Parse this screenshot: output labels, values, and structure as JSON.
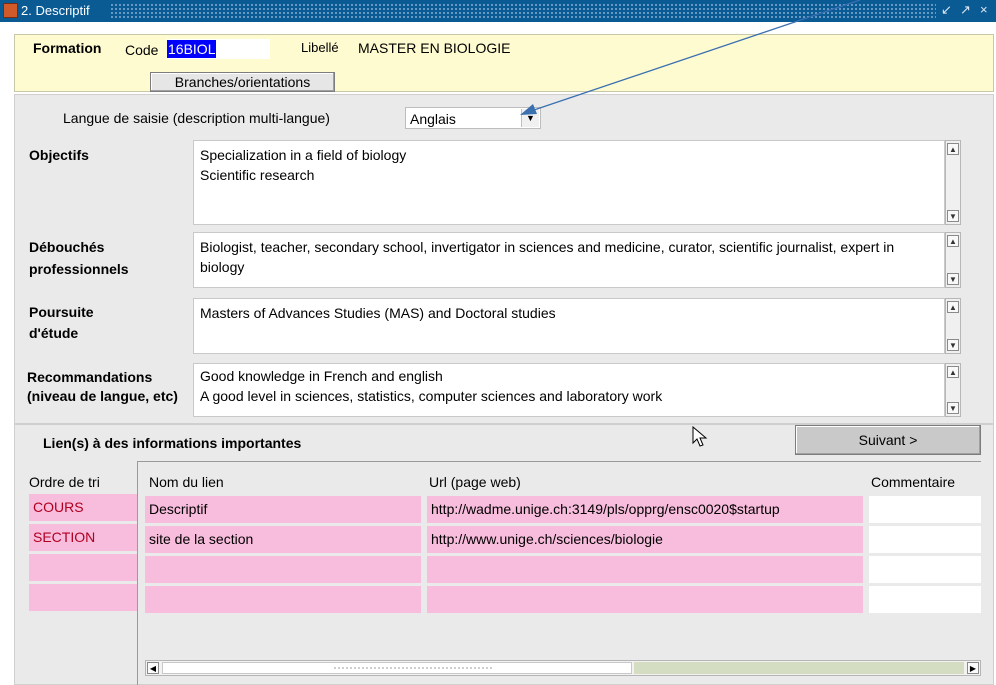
{
  "window": {
    "title": "2. Descriptif",
    "controls": [
      "↙",
      "↗",
      "×"
    ]
  },
  "formation": {
    "section_label": "Formation",
    "code_label": "Code",
    "code_value": "16BIOL",
    "libelle_label": "Libellé",
    "libelle_value": "MASTER EN BIOLOGIE",
    "branches_button": "Branches/orientations"
  },
  "langue": {
    "label": "Langue de saisie (description multi-langue)",
    "selected": "Anglais"
  },
  "objectifs": {
    "label": "Objectifs",
    "text": "Specialization in a field of biology\nScientific research"
  },
  "debouches": {
    "label": "Débouchés professionnels",
    "text": "Biologist, teacher, secondary school, invertigator in sciences and medicine, curator, scientific journalist, expert in biology"
  },
  "poursuite": {
    "label": "Poursuite d'étude",
    "text": "Masters of Advances Studies (MAS) and Doctoral studies"
  },
  "recommandations": {
    "label": "Recommandations (niveau de langue, etc)",
    "text": "Good knowledge in French and english\nA good level in sciences, statistics, computer sciences and laboratory work"
  },
  "liens": {
    "title": "Lien(s) à des informations importantes",
    "next_button": "Suivant >",
    "columns": {
      "ordre": "Ordre de tri",
      "nom": "Nom du lien",
      "url": "Url (page web)",
      "commentaire": "Commentaire"
    },
    "rows": [
      {
        "ordre": "COURS",
        "nom": "Descriptif",
        "url": "http://wadme.unige.ch:3149/pls/opprg/ensc0020$startup",
        "commentaire": ""
      },
      {
        "ordre": "SECTION",
        "nom": "site de la section",
        "url": "http://www.unige.ch/sciences/biologie",
        "commentaire": ""
      },
      {
        "ordre": "",
        "nom": "",
        "url": "",
        "commentaire": ""
      },
      {
        "ordre": "",
        "nom": "",
        "url": "",
        "commentaire": ""
      }
    ]
  },
  "colors": {
    "titlebar": "#0a5a94",
    "selection": "#0000ff",
    "pink_row": "#f8bcdc",
    "formation_bg": "#fffbd0",
    "annotation_arrow": "#3a6fb0"
  }
}
